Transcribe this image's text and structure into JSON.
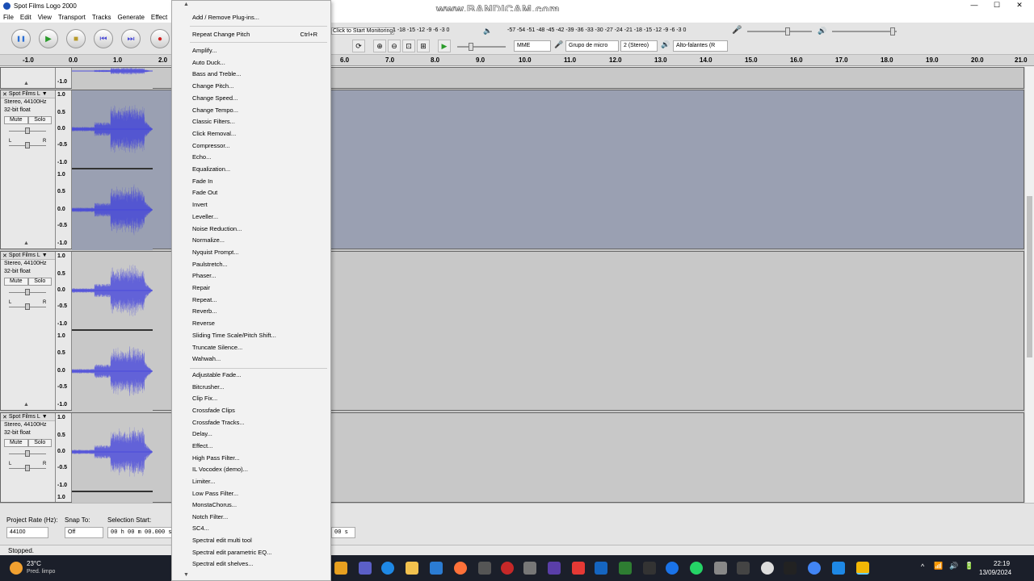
{
  "window": {
    "title": "Spot Films Logo 2000",
    "minimize": "—",
    "maximize": "☐",
    "close": "✕"
  },
  "watermark": "www.BANDICAM.com",
  "menu": [
    "File",
    "Edit",
    "View",
    "Transport",
    "Tracks",
    "Generate",
    "Effect"
  ],
  "toolbar": {
    "pause": "❚❚",
    "play": "▶",
    "stop": "■",
    "skip_start": "⏮",
    "skip_end": "⏭",
    "record": "●",
    "monitor_text": "Click to Start Monitoring",
    "meter_scale_top": "-57 -54 -51 -48 -45 -42 -39 -36 -33 -30 -27 -24 -21 -18 -15 -12 -9 -6 -3 0",
    "meter_scale_short": "1 -18 -15 -12  -9  -6  -3  0",
    "meter_scale_bottom": "-57 -54 -51 -48 -45 -42 -39 -36 -33 -30 -27 -24 -21 -18 -15 -12 -9 -6 -3 0",
    "host": "MME",
    "recording_device": "Grupo de micro",
    "channels": "2 (Stereo)",
    "playback_device": "Alto-falantes (R"
  },
  "ruler": [
    "-1.0",
    "0.0",
    "1.0",
    "2.0",
    "6.0",
    "7.0",
    "8.0",
    "9.0",
    "10.0",
    "11.0",
    "12.0",
    "13.0",
    "14.0",
    "15.0",
    "16.0",
    "17.0",
    "18.0",
    "19.0",
    "20.0",
    "21.0"
  ],
  "tracks": [
    {
      "name": "Spot Films L",
      "rate": "Stereo, 44100Hz",
      "format": "32-bit float",
      "mute": "Mute",
      "solo": "Solo",
      "pan_l": "L",
      "pan_r": "R"
    },
    {
      "name": "Spot Films L",
      "rate": "Stereo, 44100Hz",
      "format": "32-bit float",
      "mute": "Mute",
      "solo": "Solo",
      "pan_l": "L",
      "pan_r": "R"
    },
    {
      "name": "Spot Films L",
      "rate": "Stereo, 44100Hz",
      "format": "32-bit float",
      "mute": "Mute",
      "solo": "Solo",
      "pan_l": "L",
      "pan_r": "R"
    }
  ],
  "vruler": {
    "top": "1.0",
    "upper": "0.5",
    "mid": "0.0",
    "lower": "-0.5",
    "bottom": "-1.0"
  },
  "effect_menu": {
    "add_remove": "Add / Remove Plug-ins...",
    "repeat": "Repeat Change Pitch",
    "repeat_shortcut": "Ctrl+R",
    "builtin": [
      "Amplify...",
      "Auto Duck...",
      "Bass and Treble...",
      "Change Pitch...",
      "Change Speed...",
      "Change Tempo...",
      "Classic Filters...",
      "Click Removal...",
      "Compressor...",
      "Echo...",
      "Equalization...",
      "Fade In",
      "Fade Out",
      "Invert",
      "Leveller...",
      "Noise Reduction...",
      "Normalize...",
      "Nyquist Prompt...",
      "Paulstretch...",
      "Phaser...",
      "Repair",
      "Repeat...",
      "Reverb...",
      "Reverse",
      "Sliding Time Scale/Pitch Shift...",
      "Truncate Silence...",
      "Wahwah..."
    ],
    "plugins": [
      "Adjustable Fade...",
      "Bitcrusher...",
      "Clip Fix...",
      "Crossfade Clips",
      "Crossfade Tracks...",
      "Delay...",
      "Effect...",
      "High Pass Filter...",
      "IL Vocodex (demo)...",
      "Limiter...",
      "Low Pass Filter...",
      "MonstaChorus...",
      "Notch Filter...",
      "SC4...",
      "Spectral edit multi tool",
      "Spectral edit parametric EQ...",
      "Spectral edit shelves..."
    ]
  },
  "selection": {
    "project_rate_label": "Project Rate (Hz):",
    "project_rate": "44100",
    "snap_label": "Snap To:",
    "snap": "Off",
    "selection_start_label": "Selection Start:",
    "selection_start": "00 h 00 m 00.000 s",
    "selection_end_tail": "00 s"
  },
  "status": "Stopped.",
  "taskbar": {
    "temp": "23°C",
    "weather": "Pred. limpo",
    "time": "22:19",
    "date": "13/09/2024"
  }
}
